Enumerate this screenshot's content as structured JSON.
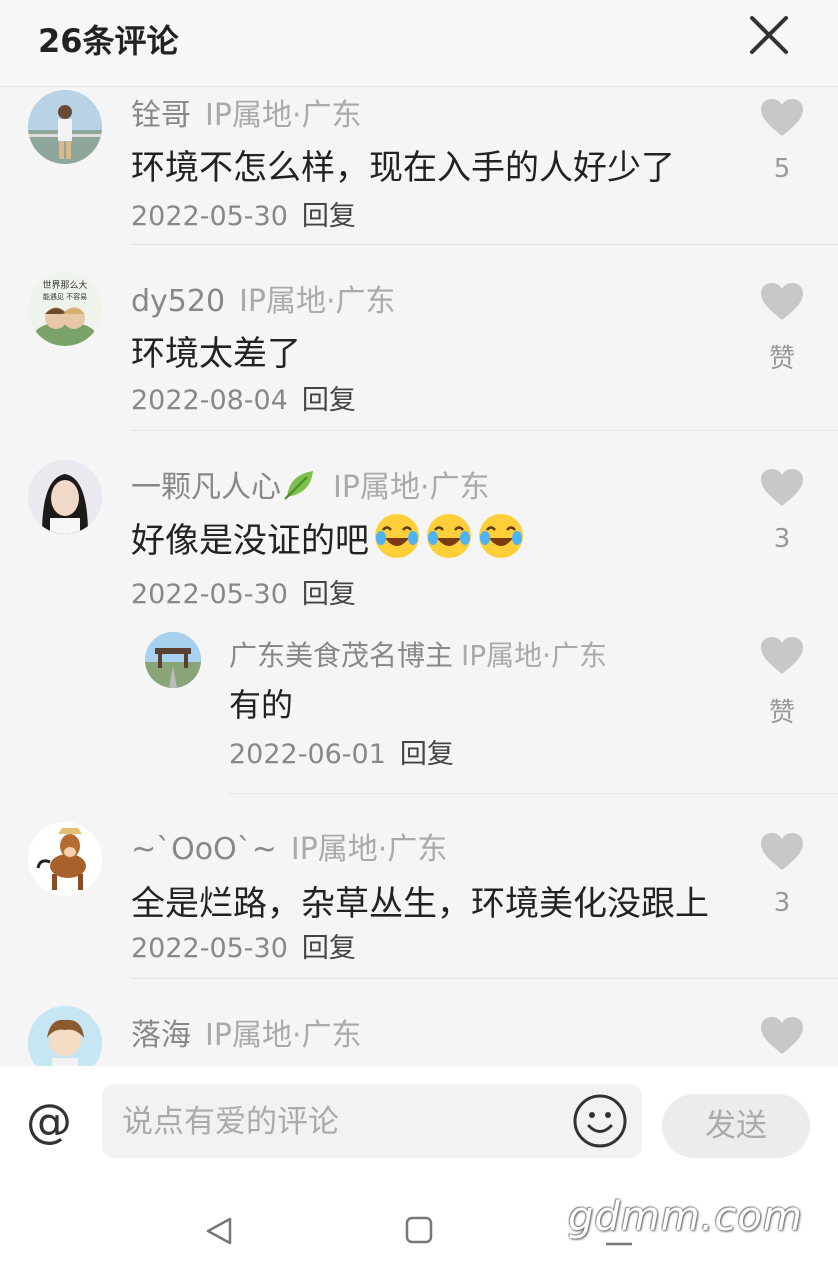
{
  "header": {
    "title": "26条评论"
  },
  "comments": [
    {
      "name": "铨哥",
      "ip": "IP属地·广东",
      "text": "环境不怎么样，现在入手的人好少了",
      "date": "2022-05-30",
      "reply": "回复",
      "likes": "5"
    },
    {
      "name": "dy520",
      "ip": "IP属地·广东",
      "text": "环境太差了",
      "date": "2022-08-04",
      "reply": "回复",
      "likes": "赞"
    },
    {
      "name": "一颗凡人心",
      "ip": "IP属地·广东",
      "text": "好像是没证的吧",
      "date": "2022-05-30",
      "reply": "回复",
      "likes": "3",
      "replies": [
        {
          "name": "广东美食茂名博主",
          "ip": "IP属地·广东",
          "text": "有的",
          "date": "2022-06-01",
          "reply": "回复",
          "likes": "赞"
        }
      ]
    },
    {
      "name": "~`OoO`~",
      "ip": "IP属地·广东",
      "text": "全是烂路，杂草丛生，环境美化没跟上",
      "date": "2022-05-30",
      "reply": "回复",
      "likes": "3"
    },
    {
      "name": "落海",
      "ip": "IP属地·广东"
    }
  ],
  "composer": {
    "at_symbol": "@",
    "placeholder": "说点有爱的评论",
    "send_label": "发送"
  },
  "watermark": "gdmm.com",
  "icons": {
    "close": "close-icon",
    "like": "heart-icon",
    "emoji": "smiley-icon",
    "nav_back": "triangle-back-icon",
    "nav_home": "square-home-icon"
  },
  "colors": {
    "like_gray": "#c8c8c8",
    "text_gray": "#888888"
  }
}
